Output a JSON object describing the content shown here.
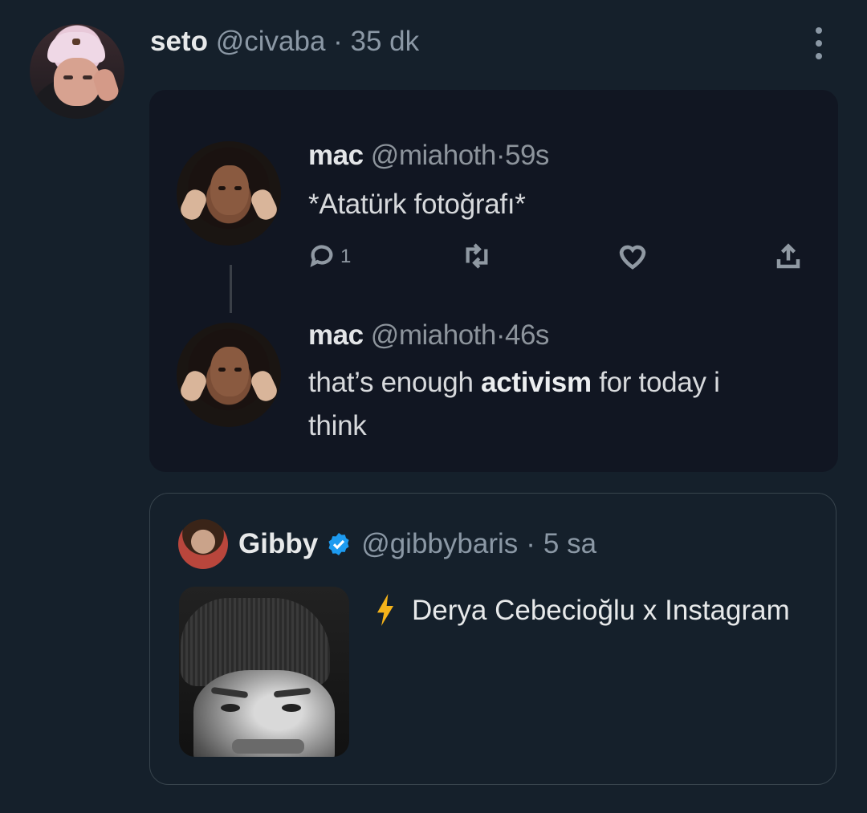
{
  "tweet": {
    "display_name": "seto",
    "handle": "@civaba",
    "separator": "·",
    "time": "35 dk"
  },
  "embedded_screenshot": {
    "post1": {
      "name": "mac",
      "handle": "@miahoth",
      "separator": "·",
      "time": "59s",
      "text": "*Atatürk fotoğrafı*",
      "reply_count": "1"
    },
    "post2": {
      "name": "mac",
      "handle": "@miahoth",
      "separator": "·",
      "time": "46s",
      "text_before": "that’s enough",
      "text_bold": "activism",
      "text_after": " for today i",
      "text_line2": "think"
    }
  },
  "quote": {
    "display_name": "Gibby",
    "handle": "@gibbybaris",
    "separator": "·",
    "time": "5 sa",
    "verified": true,
    "text": "Derya Cebecioğlu x Instagram",
    "emoji_icon": "lightning-bolt-icon"
  },
  "colors": {
    "background": "#15202b",
    "verified_blue": "#1d9bf0",
    "muted": "#8b98a5",
    "bolt": "#f5b31a"
  }
}
